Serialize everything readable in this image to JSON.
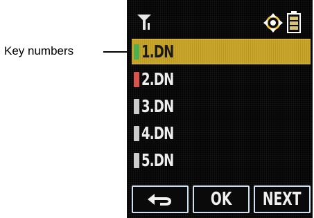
{
  "callout": {
    "label": "Key numbers"
  },
  "status": {
    "signal_icon": "signal-antenna-icon",
    "nav_icon": "navigation-pad-icon",
    "battery_icon": "battery-icon"
  },
  "list": {
    "items": [
      {
        "label": "1.DN",
        "key_color": "#4caf50",
        "selected": true
      },
      {
        "label": "2.DN",
        "key_color": "#d9534f",
        "selected": false
      },
      {
        "label": "3.DN",
        "key_color": "#cccccc",
        "selected": false
      },
      {
        "label": "4.DN",
        "key_color": "#cccccc",
        "selected": false
      },
      {
        "label": "5.DN",
        "key_color": "#cccccc",
        "selected": false
      }
    ]
  },
  "softkeys": {
    "back_icon": "back-arrow-icon",
    "ok_label": "OK",
    "next_label": "NEXT"
  },
  "colors": {
    "selection_bar": "#c9a52a",
    "screen_bg": "#050505",
    "softkey_border": "#cfe0f0"
  }
}
